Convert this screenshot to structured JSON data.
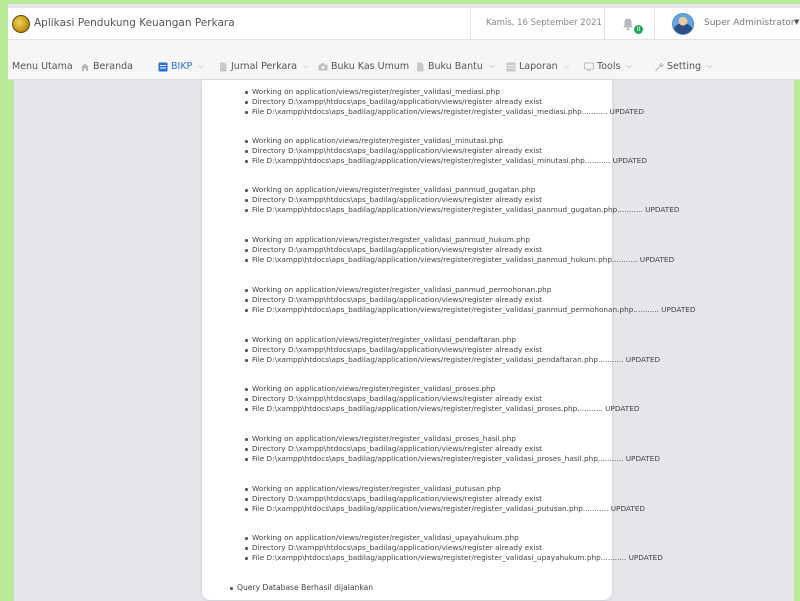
{
  "header": {
    "app_title": "Aplikasi Pendukung Keuangan Perkara",
    "date": "Kamis, 16 September 2021",
    "notification_count": "0",
    "user_name": "Super Administrator"
  },
  "nav": {
    "menu_label": "Menu Utama",
    "items": [
      {
        "label": "Beranda",
        "icon": "home-icon"
      },
      {
        "label": "BIKP",
        "icon": "book-icon",
        "active": true
      },
      {
        "label": "Jurnal Perkara",
        "icon": "file-icon"
      },
      {
        "label": "Buku Kas Umum",
        "icon": "camera-icon"
      },
      {
        "label": "Buku Bantu",
        "icon": "file-icon"
      },
      {
        "label": "Laporan",
        "icon": "table-icon"
      },
      {
        "label": "Tools",
        "icon": "monitor-icon"
      },
      {
        "label": "Setting",
        "icon": "wrench-icon"
      }
    ]
  },
  "log": {
    "groups": [
      [
        "Working on application/views/register/register_validasi_mediasi.php",
        "Directory D:\\xampp\\htdocs\\aps_badilag/application/views/register already exist",
        "File D:\\xampp\\htdocs\\aps_badilag/application/views/register/register_validasi_mediasi.php........... UPDATED"
      ],
      [
        "Working on application/views/register/register_validasi_minutasi.php",
        "Directory D:\\xampp\\htdocs\\aps_badilag/application/views/register already exist",
        "File D:\\xampp\\htdocs\\aps_badilag/application/views/register/register_validasi_minutasi.php........... UPDATED"
      ],
      [
        "Working on application/views/register/register_validasi_panmud_gugatan.php",
        "Directory D:\\xampp\\htdocs\\aps_badilag/application/views/register already exist",
        "File D:\\xampp\\htdocs\\aps_badilag/application/views/register/register_validasi_panmud_gugatan.php........... UPDATED"
      ],
      [
        "Working on application/views/register/register_validasi_panmud_hukum.php",
        "Directory D:\\xampp\\htdocs\\aps_badilag/application/views/register already exist",
        "File D:\\xampp\\htdocs\\aps_badilag/application/views/register/register_validasi_panmud_hukum.php........... UPDATED"
      ],
      [
        "Working on application/views/register/register_validasi_panmud_permohonan.php",
        "Directory D:\\xampp\\htdocs\\aps_badilag/application/views/register already exist",
        "File D:\\xampp\\htdocs\\aps_badilag/application/views/register/register_validasi_panmud_permohonan.php........... UPDATED"
      ],
      [
        "Working on application/views/register/register_validasi_pendaftaran.php",
        "Directory D:\\xampp\\htdocs\\aps_badilag/application/views/register already exist",
        "File D:\\xampp\\htdocs\\aps_badilag/application/views/register/register_validasi_pendaftaran.php........... UPDATED"
      ],
      [
        "Working on application/views/register/register_validasi_proses.php",
        "Directory D:\\xampp\\htdocs\\aps_badilag/application/views/register already exist",
        "File D:\\xampp\\htdocs\\aps_badilag/application/views/register/register_validasi_proses.php........... UPDATED"
      ],
      [
        "Working on application/views/register/register_validasi_proses_hasil.php",
        "Directory D:\\xampp\\htdocs\\aps_badilag/application/views/register already exist",
        "File D:\\xampp\\htdocs\\aps_badilag/application/views/register/register_validasi_proses_hasil.php........... UPDATED"
      ],
      [
        "Working on application/views/register/register_validasi_putusan.php",
        "Directory D:\\xampp\\htdocs\\aps_badilag/application/views/register already exist",
        "File D:\\xampp\\htdocs\\aps_badilag/application/views/register/register_validasi_putusan.php........... UPDATED"
      ],
      [
        "Working on application/views/register/register_validasi_upayahukum.php",
        "Directory D:\\xampp\\htdocs\\aps_badilag/application/views/register already exist",
        "File D:\\xampp\\htdocs\\aps_badilag/application/views/register/register_validasi_upayahukum.php........... UPDATED"
      ]
    ],
    "final": "Query Database Berhasil dijalankan"
  },
  "colors": {
    "accent_green": "#b8ea98",
    "active_nav": "#2b6fd6",
    "badge_green": "#1fa85a"
  }
}
